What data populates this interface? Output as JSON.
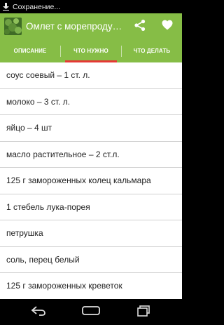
{
  "status_bar": {
    "text": "Сохранение..."
  },
  "action_bar": {
    "title": "Омлет с морепродуктами",
    "share_icon": "share-icon",
    "favorite_icon": "heart-icon"
  },
  "tabs": [
    {
      "label": "ОПИСАНИЕ"
    },
    {
      "label": "ЧТО НУЖНО"
    },
    {
      "label": "ЧТО ДЕЛАТЬ"
    }
  ],
  "ingredients": [
    "соус соевый – 1 ст. л.",
    "молоко – 3 ст. л.",
    "яйцо – 4 шт",
    "масло растительное – 2 ст.л.",
    "125 г замороженных колец кальмара",
    "1 стебель лука-порея",
    "петрушка",
    "соль, перец белый",
    "125 г замороженных креветок"
  ],
  "colors": {
    "accent_green": "#86bd46",
    "active_tab_indicator": "#e53935"
  }
}
